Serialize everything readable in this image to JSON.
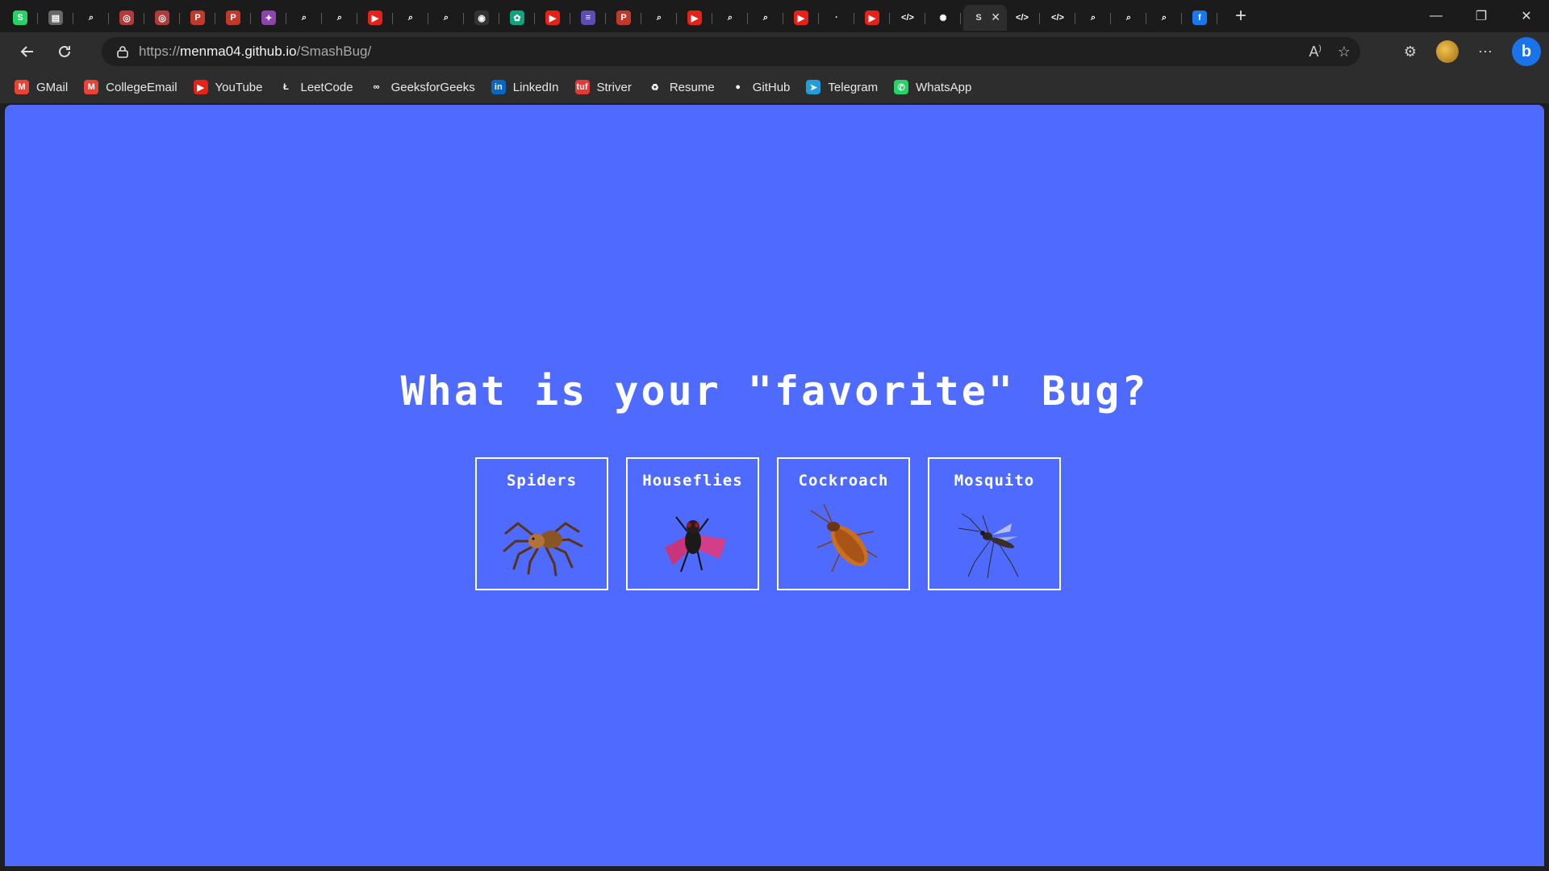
{
  "browser": {
    "tabs": [
      {
        "icon": "whatsapp-icon",
        "color": "#25d366",
        "glyph": "S"
      },
      {
        "icon": "doc-icon",
        "color": "#666666",
        "glyph": "▤"
      },
      {
        "icon": "search-icon",
        "color": "#1b1b1b",
        "glyph": "⌕"
      },
      {
        "icon": "app-icon",
        "color": "#b23a3a",
        "glyph": "◎"
      },
      {
        "icon": "app-icon",
        "color": "#b23a3a",
        "glyph": "◎"
      },
      {
        "icon": "pdf-icon",
        "color": "#c0392b",
        "glyph": "P"
      },
      {
        "icon": "pdf-icon",
        "color": "#c0392b",
        "glyph": "P"
      },
      {
        "icon": "game-icon",
        "color": "#8e44ad",
        "glyph": "✦"
      },
      {
        "icon": "search-icon",
        "color": "#1b1b1b",
        "glyph": "⌕"
      },
      {
        "icon": "search-icon",
        "color": "#1b1b1b",
        "glyph": "⌕"
      },
      {
        "icon": "youtube-icon",
        "color": "#e62117",
        "glyph": "▶"
      },
      {
        "icon": "search-icon",
        "color": "#1b1b1b",
        "glyph": "⌕"
      },
      {
        "icon": "search-icon",
        "color": "#1b1b1b",
        "glyph": "⌕"
      },
      {
        "icon": "spiral-icon",
        "color": "#333333",
        "glyph": "◉"
      },
      {
        "icon": "chatgpt-icon",
        "color": "#10a37f",
        "glyph": "✿"
      },
      {
        "icon": "youtube-icon",
        "color": "#e62117",
        "glyph": "▶"
      },
      {
        "icon": "list-icon",
        "color": "#5b4db3",
        "glyph": "≡"
      },
      {
        "icon": "pdf-icon",
        "color": "#c0392b",
        "glyph": "P"
      },
      {
        "icon": "search-icon",
        "color": "#1b1b1b",
        "glyph": "⌕"
      },
      {
        "icon": "youtube-icon",
        "color": "#e62117",
        "glyph": "▶"
      },
      {
        "icon": "search-icon",
        "color": "#1b1b1b",
        "glyph": "⌕"
      },
      {
        "icon": "search-icon",
        "color": "#1b1b1b",
        "glyph": "⌕"
      },
      {
        "icon": "youtube-icon",
        "color": "#e62117",
        "glyph": "▶"
      },
      {
        "icon": "blank-icon",
        "color": "#1b1b1b",
        "glyph": "·"
      },
      {
        "icon": "youtube-icon",
        "color": "#e62117",
        "glyph": "▶"
      },
      {
        "icon": "code-icon",
        "color": "#1b1b1b",
        "glyph": "</>"
      },
      {
        "icon": "openai-icon",
        "color": "#1b1b1b",
        "glyph": "✺"
      }
    ],
    "active_tab": {
      "glyph": "S",
      "close": "✕"
    },
    "tabs_after": [
      {
        "icon": "code-icon",
        "color": "#1b1b1b",
        "glyph": "</>"
      },
      {
        "icon": "code-icon",
        "color": "#1b1b1b",
        "glyph": "</>"
      },
      {
        "icon": "search-icon",
        "color": "#1b1b1b",
        "glyph": "⌕"
      },
      {
        "icon": "search-icon",
        "color": "#1b1b1b",
        "glyph": "⌕"
      },
      {
        "icon": "search-icon",
        "color": "#1b1b1b",
        "glyph": "⌕"
      },
      {
        "icon": "facebook-icon",
        "color": "#1877f2",
        "glyph": "f"
      }
    ],
    "new_tab": "+",
    "window": {
      "minimize": "—",
      "restore": "❐",
      "close": "✕"
    },
    "url_prefix": "https://",
    "url_host": "menma04.github.io",
    "url_path": "/SmashBug/",
    "bookmarks": [
      {
        "label": "GMail",
        "icon": "gmail-icon",
        "color": "#ea4335",
        "glyph": "M"
      },
      {
        "label": "CollegeEmail",
        "icon": "gmail-icon",
        "color": "#ea4335",
        "glyph": "M"
      },
      {
        "label": "YouTube",
        "icon": "youtube-icon",
        "color": "#e62117",
        "glyph": "▶"
      },
      {
        "label": "LeetCode",
        "icon": "leetcode-icon",
        "color": "#2d2d2d",
        "glyph": "Ł"
      },
      {
        "label": "GeeksforGeeks",
        "icon": "gfg-icon",
        "color": "#2d2d2d",
        "glyph": "∞"
      },
      {
        "label": "LinkedIn",
        "icon": "linkedin-icon",
        "color": "#0a66c2",
        "glyph": "in"
      },
      {
        "label": "Striver",
        "icon": "striver-icon",
        "color": "#e53935",
        "glyph": "tuf"
      },
      {
        "label": "Resume",
        "icon": "resume-icon",
        "color": "#2d2d2d",
        "glyph": "♻"
      },
      {
        "label": "GitHub",
        "icon": "github-icon",
        "color": "#2d2d2d",
        "glyph": "●"
      },
      {
        "label": "Telegram",
        "icon": "telegram-icon",
        "color": "#229ed9",
        "glyph": "➤"
      },
      {
        "label": "WhatsApp",
        "icon": "whatsapp-icon",
        "color": "#25d366",
        "glyph": "✆"
      }
    ]
  },
  "page": {
    "headline": "What is your \"favorite\" Bug?",
    "background": "#4f6bff",
    "bugs": [
      {
        "label": "Spiders",
        "icon": "spider-icon"
      },
      {
        "label": "Houseflies",
        "icon": "housefly-icon"
      },
      {
        "label": "Cockroach",
        "icon": "cockroach-icon"
      },
      {
        "label": "Mosquito",
        "icon": "mosquito-icon"
      }
    ]
  }
}
